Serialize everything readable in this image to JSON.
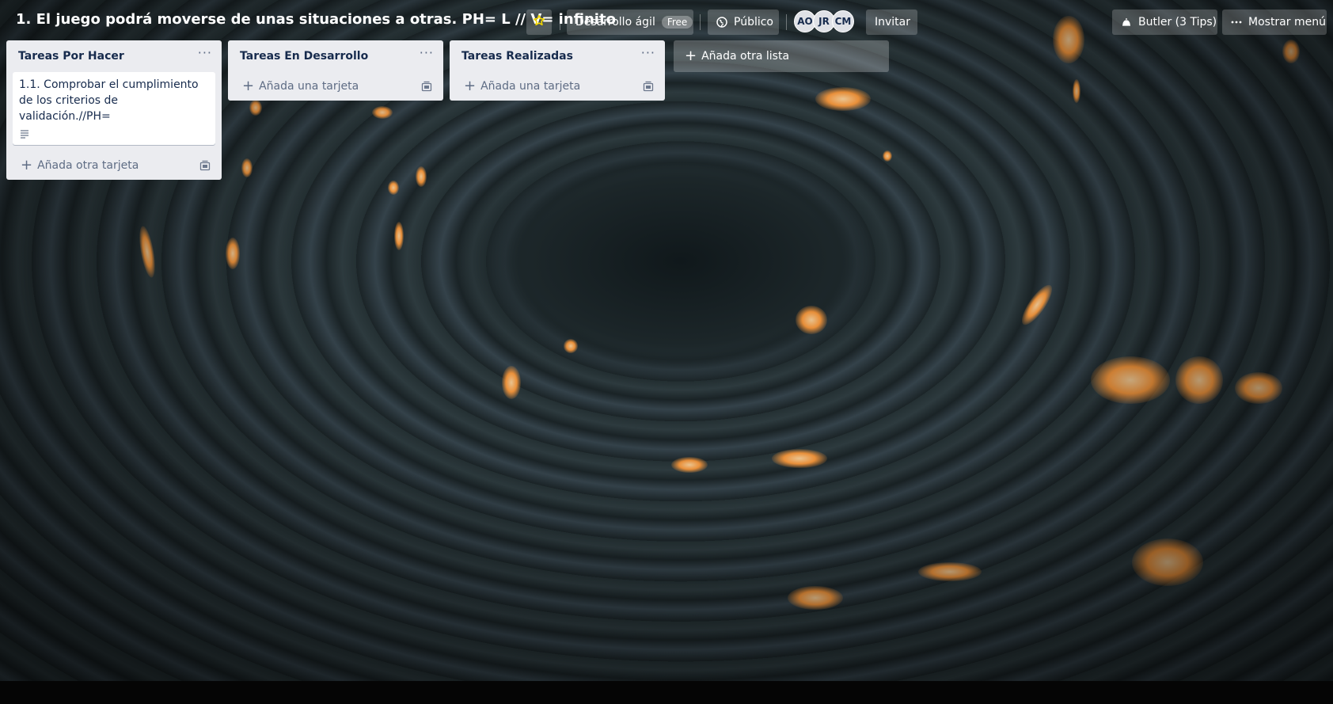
{
  "board": {
    "title": "1. El juego podrá moverse de unas situaciones a otras. PH= L // V= infinito",
    "star_icon": "star-icon",
    "workspace_label": "Desarrollo ágil",
    "workspace_plan": "Free",
    "visibility_label": "Público",
    "visibility_icon": "globe-icon",
    "members": [
      "AO",
      "JR",
      "CM"
    ],
    "invite_label": "Invitar",
    "butler_label": "Butler (3 Tips)",
    "butler_icon": "butler-icon",
    "menu_label": "Mostrar menú",
    "menu_icon": "more-icon",
    "accent": "#f2d600"
  },
  "lists": [
    {
      "title": "Tareas Por Hacer",
      "cards": [
        {
          "title": "1.1. Comprobar el cumplimiento de los criterios de validación.//PH=",
          "badge_icon": "description-icon"
        }
      ],
      "add_label": "Añada otra tarjeta"
    },
    {
      "title": "Tareas En Desarrollo",
      "cards": [],
      "add_label": "Añada una tarjeta"
    },
    {
      "title": "Tareas Realizadas",
      "cards": [],
      "add_label": "Añada una tarjeta"
    }
  ],
  "add_list_label": "Añada otra lista"
}
